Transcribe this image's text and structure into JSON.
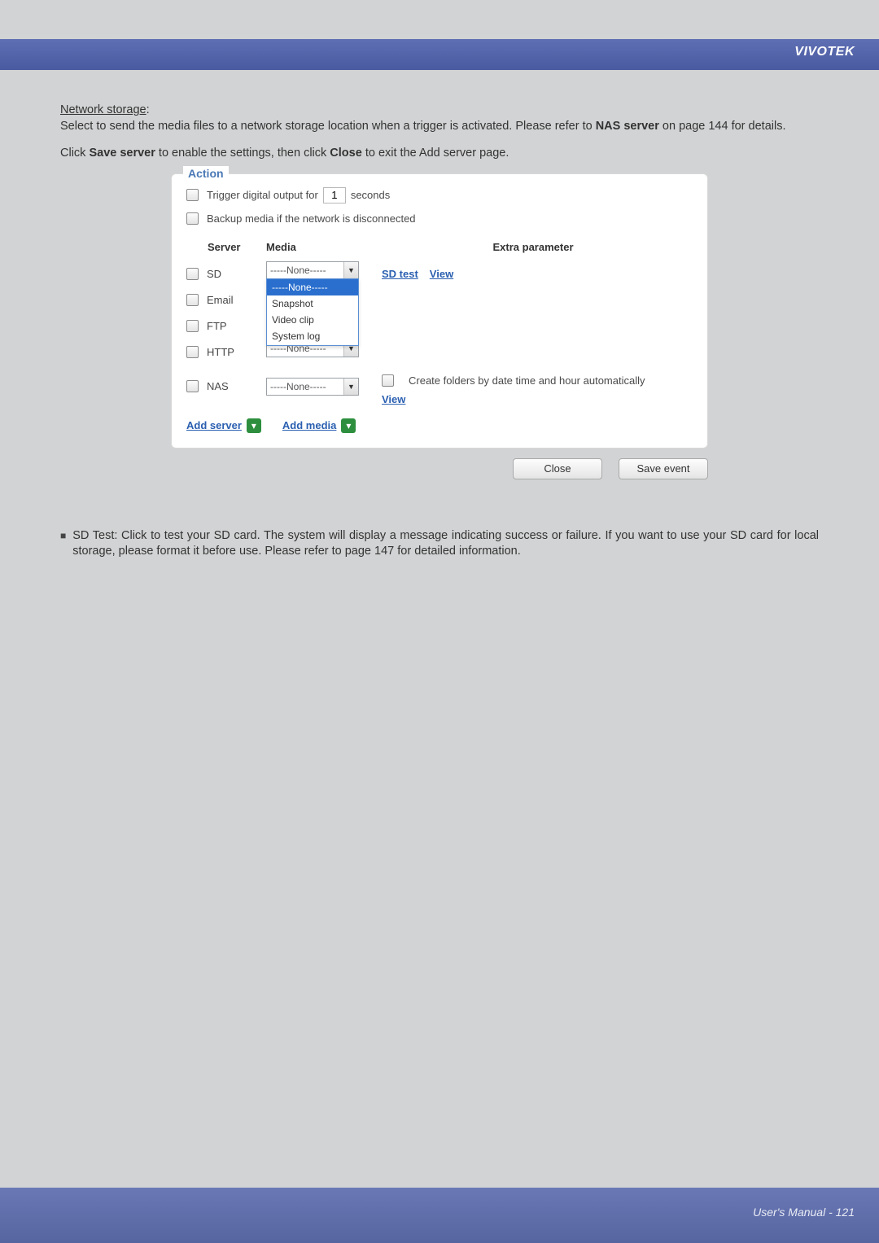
{
  "brand": "VIVOTEK",
  "intro": {
    "title": "Network storage",
    "line1_a": "Select to send the media files to a network storage location when a trigger is activated. Please refer to ",
    "line1_b": "NAS server",
    "line1_c": " on page 144 for details.",
    "line2_a": "Click ",
    "line2_b": "Save server",
    "line2_c": " to enable the settings, then click ",
    "line2_d": "Close",
    "line2_e": " to exit the Add server page."
  },
  "panel": {
    "legend": "Action",
    "trigger_a": "Trigger digital output for",
    "trigger_value": "1",
    "trigger_b": "seconds",
    "backup_label": "Backup media if the network is disconnected",
    "headers": {
      "server": "Server",
      "media": "Media",
      "extra": "Extra parameter"
    },
    "rows": {
      "sd": {
        "label": "SD",
        "media": "-----None-----"
      },
      "email": {
        "label": "Email"
      },
      "ftp": {
        "label": "FTP"
      },
      "http": {
        "label": "HTTP",
        "media": "-----None-----"
      },
      "nas": {
        "label": "NAS",
        "media": "-----None-----"
      }
    },
    "dropdown_options": [
      "-----None-----",
      "Snapshot",
      "Video clip",
      "System log"
    ],
    "sd_extra": {
      "sd_test": "SD test",
      "view": "View"
    },
    "nas_extra": {
      "folders": "Create folders by date time and hour automatically",
      "view": "View"
    },
    "add_server": "Add server",
    "add_media": "Add media"
  },
  "buttons": {
    "close": "Close",
    "save": "Save event"
  },
  "bullet": {
    "text": "SD Test: Click to test your SD card. The system will display a message indicating success or failure. If you want to use your SD card for local storage, please format it before use. Please refer to page 147 for detailed information."
  },
  "footer": "User's Manual - 121"
}
